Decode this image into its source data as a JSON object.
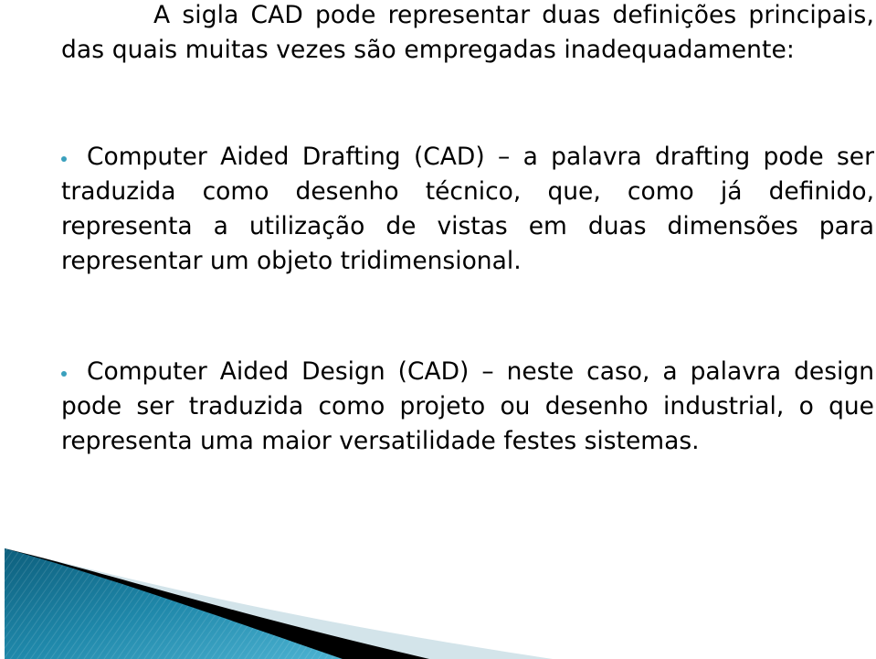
{
  "intro": {
    "text": "A sigla CAD pode representar duas definições principais, das quais muitas vezes são empregadas inadequadamente:"
  },
  "bullets": [
    {
      "icon": "bullet-dot-icon",
      "text": "Computer Aided Drafting (CAD) – a palavra drafting pode ser traduzida como desenho técnico, que, como já definido, representa a utilização de vistas em duas dimensões para representar um objeto tridimensional."
    },
    {
      "icon": "bullet-dot-icon",
      "text": "Computer Aided Design (CAD) – neste caso, a palavra design pode ser traduzida como projeto ou desenho industrial, o que representa uma maior versatilidade festes sistemas."
    }
  ],
  "colors": {
    "bullet": "#3aa0bd",
    "wave_blue_dark": "#0e6f8f",
    "wave_blue_light": "#3fa6c6",
    "wave_black": "#000000",
    "wave_pale": "#d3e4ea"
  }
}
